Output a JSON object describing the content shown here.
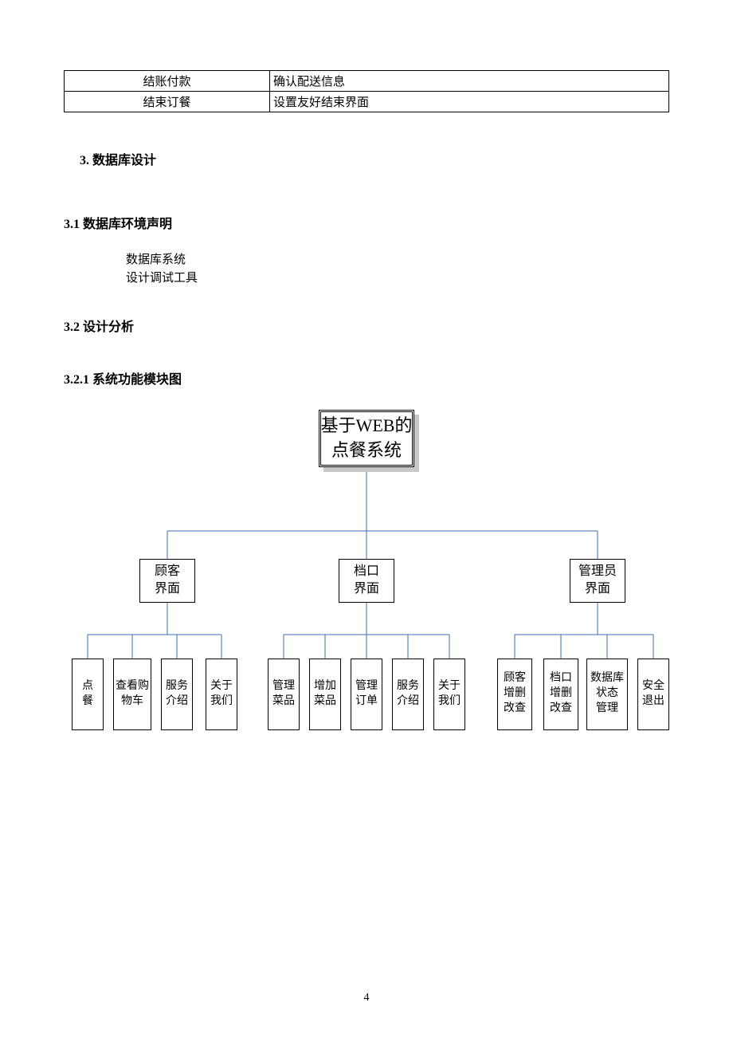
{
  "table": {
    "rows": [
      {
        "c1": "结账付款",
        "c2": "确认配送信息"
      },
      {
        "c1": "结束订餐",
        "c2": "设置友好结束界面"
      }
    ]
  },
  "headings": {
    "h1": "3. 数据库设计",
    "h2a": "3.1 数据库环境声明",
    "indent_line1": "数据库系统",
    "indent_line2": "设计调试工具",
    "h2b": "3.2 设计分析",
    "h3": "3.2.1  系统功能模块图"
  },
  "diagram": {
    "root": "基于WEB的\n点餐系统",
    "mids": [
      {
        "id": "m1",
        "label": "顾客\n界面"
      },
      {
        "id": "m2",
        "label": "档口\n界面"
      },
      {
        "id": "m3",
        "label": "管理员\n界面"
      }
    ],
    "leaves_g1": [
      "点\n餐",
      "查看购\n物车",
      "服务\n介绍",
      "关于\n我们"
    ],
    "leaves_g2": [
      "管理\n菜品",
      "增加\n菜品",
      "管理\n订单",
      "服务\n介绍",
      "关于\n我们"
    ],
    "leaves_g3": [
      "顾客\n增删\n改查",
      "档口\n增删\n改查",
      "数据库\n状态\n管理",
      "安全\n退出"
    ]
  },
  "page_number": "4"
}
